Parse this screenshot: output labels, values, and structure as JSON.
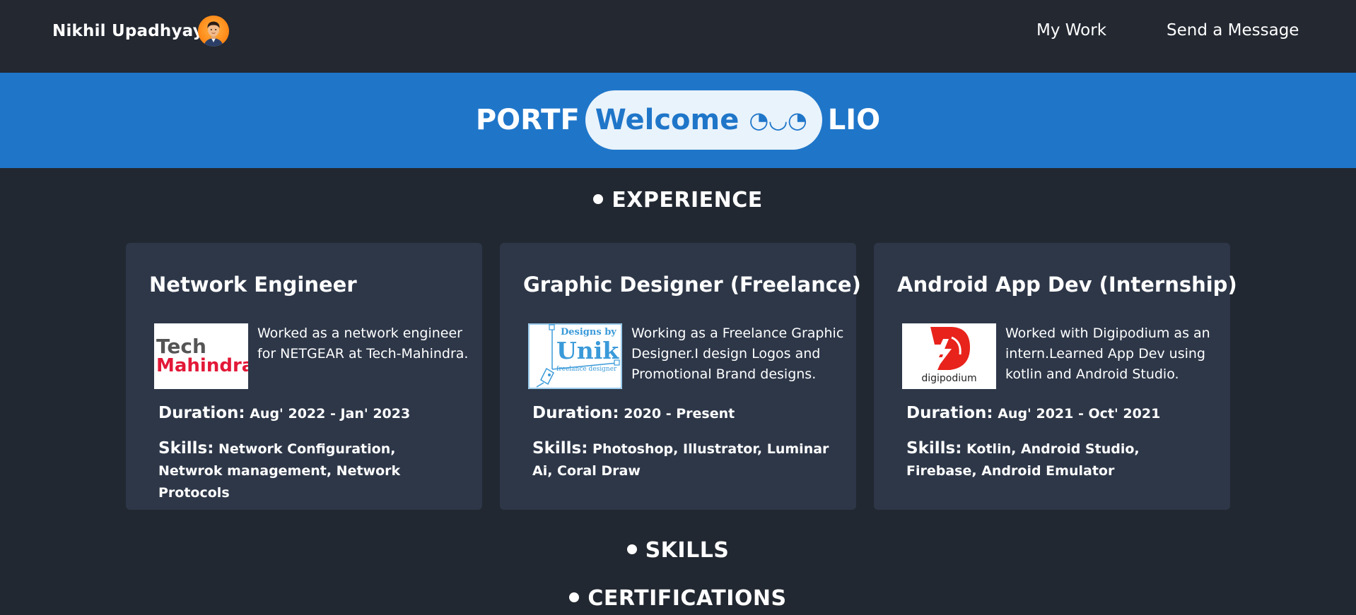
{
  "nav": {
    "brand": "Nikhil Upadhyay",
    "links": [
      "My Work",
      "Send a Message"
    ]
  },
  "banner": {
    "left": "PORTF",
    "welcome": "Welcome",
    "emoji": "◔◡◔",
    "right": "LIO"
  },
  "sections": {
    "experience": "EXPERIENCE",
    "skills": "SKILLS",
    "certifications": "CERTIFICATIONS"
  },
  "experience": [
    {
      "title": "Network Engineer",
      "logo": "tech-mahindra-logo",
      "logo_text": [
        "Tech",
        "Mahindra"
      ],
      "description": "Worked as a network engineer for NETGEAR at Tech-Mahindra.",
      "duration_label": "Duration:",
      "duration": "Aug' 2022 - Jan' 2023",
      "skills_label": "Skills:",
      "skills": "Network Configuration, Netwrok management, Network Protocols"
    },
    {
      "title": "Graphic Designer (Freelance)",
      "logo": "designs-by-unik-logo",
      "logo_text": [
        "Designs by",
        "Unik",
        "freelance designer"
      ],
      "description": "Working as a Freelance Graphic Designer.I design Logos and Promotional Brand designs.",
      "duration_label": "Duration:",
      "duration": "2020 - Present",
      "skills_label": "Skills:",
      "skills": "Photoshop, Illustrator, Luminar Ai, Coral Draw"
    },
    {
      "title": "Android App Dev (Internship)",
      "logo": "digipodium-logo",
      "logo_text": [
        "digipodium"
      ],
      "description": "Worked with Digipodium as an intern.Learned App Dev using kotlin and Android Studio.",
      "duration_label": "Duration:",
      "duration": "Aug' 2021 - Oct' 2021",
      "skills_label": "Skills:",
      "skills": "Kotlin, Android Studio, Firebase, Android Emulator"
    }
  ],
  "colors": {
    "page_bg": "#222831",
    "banner": "#1f76c9",
    "card_bg": "#2d3748",
    "pill_bg": "#e9f3fb",
    "tech_mahindra_red": "#e31837",
    "digipodium_red": "#e8231b",
    "unik_blue": "#3a9ad9"
  }
}
